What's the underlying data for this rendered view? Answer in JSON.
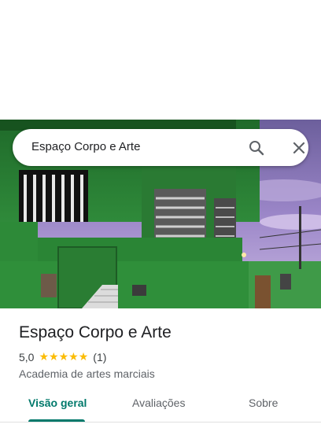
{
  "search": {
    "query": "Espaço Corpo e Arte",
    "search_icon": "search-icon",
    "close_icon": "close-icon"
  },
  "place": {
    "title": "Espaço Corpo e Arte",
    "rating": "5,0",
    "stars_filled": 5,
    "stars_total": 5,
    "review_count": "(1)",
    "category": "Academia de artes marciais"
  },
  "tabs": [
    {
      "label": "Visão geral",
      "active": true
    },
    {
      "label": "Avaliações",
      "active": false
    },
    {
      "label": "Sobre",
      "active": false
    }
  ],
  "colors": {
    "accent": "#00796b",
    "star": "#fbbc04",
    "building_green": "#2e7d32"
  }
}
